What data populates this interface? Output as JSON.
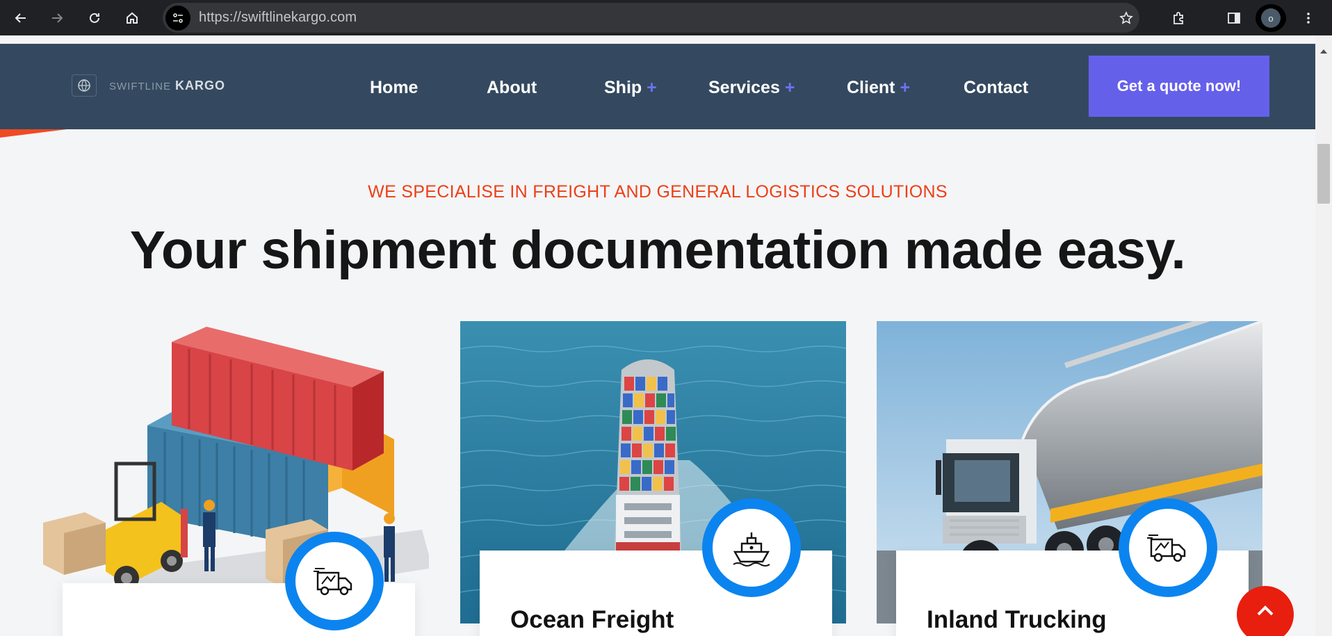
{
  "browser": {
    "url": "https://swiftlinekargo.com",
    "profile_initial": "o",
    "icons": [
      "back-arrow-icon",
      "forward-arrow-icon",
      "reload-icon",
      "home-icon",
      "site-info-icon",
      "star-icon",
      "extensions-icon",
      "side-panel-icon",
      "kebab-menu-icon"
    ]
  },
  "header": {
    "logo_light": "SWIFTLINE",
    "logo_bold": "KARGO",
    "nav": [
      {
        "label": "Home",
        "has_submenu": false
      },
      {
        "label": "About",
        "has_submenu": false
      },
      {
        "label": "Ship",
        "has_submenu": true
      },
      {
        "label": "Services",
        "has_submenu": true
      },
      {
        "label": "Client",
        "has_submenu": true
      },
      {
        "label": "Contact",
        "has_submenu": false
      }
    ],
    "submenu_marker": "+",
    "cta_label": "Get a quote now!"
  },
  "hero": {
    "eyebrow": "WE SPECIALISE IN FREIGHT AND GENERAL LOGISTICS SOLUTIONS",
    "headline": "Your shipment documentation made easy."
  },
  "services": [
    {
      "title": "",
      "icon": "delivery-truck-icon",
      "image": "containers-forklift-illustration"
    },
    {
      "title": "Ocean Freight",
      "icon": "cargo-ship-icon",
      "image": "container-ship-aerial-photo"
    },
    {
      "title": "Inland Trucking",
      "icon": "delivery-truck-icon",
      "image": "tanker-truck-photo"
    }
  ],
  "colors": {
    "header_bg": "#34495f",
    "accent_purple": "#6560ea",
    "accent_red": "#ed3f16",
    "badge_blue": "#0b84f0",
    "scroll_top_red": "#e81e0e"
  }
}
